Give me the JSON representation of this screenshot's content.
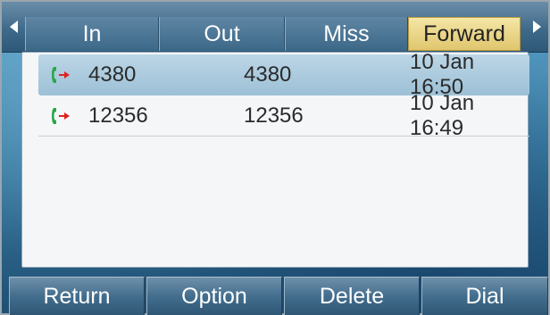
{
  "tabs": [
    {
      "label": "In",
      "active": false
    },
    {
      "label": "Out",
      "active": false
    },
    {
      "label": "Miss",
      "active": false
    },
    {
      "label": "Forward",
      "active": true
    }
  ],
  "calls": [
    {
      "name": "4380",
      "number": "4380",
      "time": "10 Jan 16:50",
      "selected": true,
      "icon": "call-forward-icon"
    },
    {
      "name": "12356",
      "number": "12356",
      "time": "10 Jan 16:49",
      "selected": false,
      "icon": "call-forward-icon"
    }
  ],
  "softkeys": {
    "return": "Return",
    "option": "Option",
    "delete": "Delete",
    "dial": "Dial"
  },
  "colors": {
    "active_tab": "#e8d27e",
    "selected_row": "#a9c9dc",
    "forward_icon_handset": "#2aa84a",
    "forward_icon_arrow": "#e02020"
  }
}
